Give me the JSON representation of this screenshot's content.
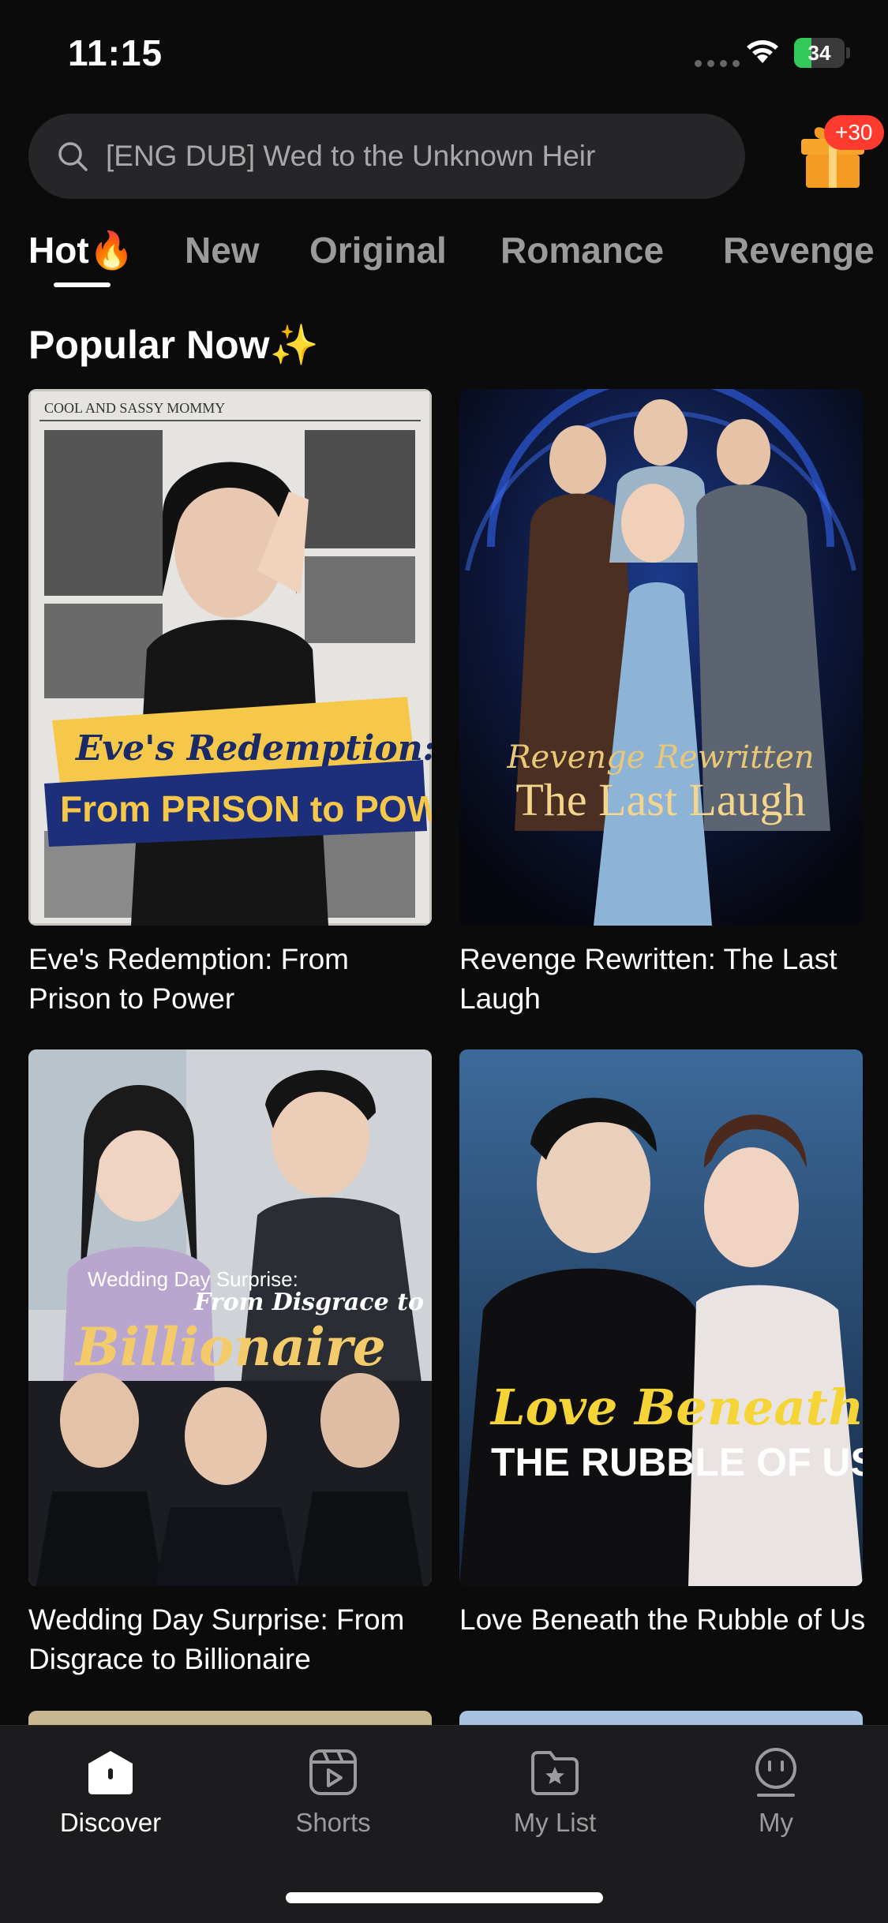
{
  "status": {
    "time": "11:15",
    "battery": "34",
    "battery_level": 0.34
  },
  "search": {
    "placeholder": "[ENG DUB] Wed to the Unknown Heir"
  },
  "gift": {
    "badge": "+30"
  },
  "tabs": [
    {
      "label": "Hot🔥",
      "active": true
    },
    {
      "label": "New"
    },
    {
      "label": "Original"
    },
    {
      "label": "Romance"
    },
    {
      "label": "Revenge"
    }
  ],
  "section": {
    "title": "Popular Now✨"
  },
  "cards": [
    {
      "title": "Eve's Redemption: From Prison to Power",
      "poster": {
        "top_text": "COOL AND SASSY MOMMY",
        "line1": "Eve's Redemption:",
        "line2": "From PRISON to POWER"
      }
    },
    {
      "title": "Revenge Rewritten: The Last Laugh",
      "poster": {
        "line1": "Revenge Rewritten",
        "line2": "The Last Laugh"
      }
    },
    {
      "title": "Wedding Day Surprise: From Disgrace to Billionaire",
      "poster": {
        "line1": "Wedding Day Surprise:",
        "line2": "From Disgrace to",
        "line3": "Billionaire"
      }
    },
    {
      "title": "Love Beneath the Rubble of Us",
      "poster": {
        "line1": "Love Beneath",
        "line2": "THE RUBBLE OF US"
      }
    }
  ],
  "bottom_nav": [
    {
      "label": "Discover",
      "icon": "discover-icon",
      "active": true
    },
    {
      "label": "Shorts",
      "icon": "shorts-icon"
    },
    {
      "label": "My List",
      "icon": "my-list-icon"
    },
    {
      "label": "My",
      "icon": "my-icon"
    }
  ],
  "colors": {
    "background": "#0b0b0c",
    "accent_gold": "#f5c84a",
    "badge_red": "#ff3b30"
  }
}
